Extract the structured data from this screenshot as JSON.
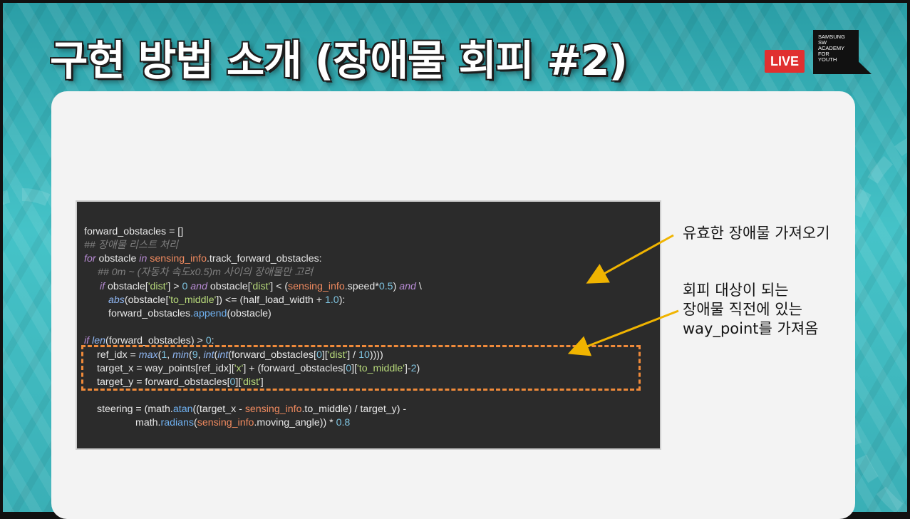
{
  "slide": {
    "title": "구현 방법 소개 (장애물 회피 #2)",
    "live_label": "LIVE",
    "brand_logo_text": "SAMSUNG\nSW\nACADEMY\nFOR\nYOUTH"
  },
  "annotations": {
    "top": "유효한 장애물 가져오기",
    "bottom_line1": "회피 대상이 되는",
    "bottom_line2": "장애물 직전에 있는",
    "bottom_line3": "way_point를 가져옴"
  },
  "code": {
    "l1": "forward_obstacles = []",
    "l2_comment": "## 장애물 리스트 처리",
    "l3_for": "for",
    "l3_a": " obstacle ",
    "l3_in": "in",
    "l3_b": " ",
    "l3_sensing": "sensing_info",
    "l3_c": ".track_forward_obstacles:",
    "l4_comment": "## 0m ~ (자동차 속도x0.5)m 사이의 장애물만 고려",
    "l5_if": "if",
    "l5_a": " obstacle[",
    "l5_dist1": "'dist'",
    "l5_b": "] > ",
    "l5_zero": "0",
    "l5_c": " ",
    "l5_and1": "and",
    "l5_d": " obstacle[",
    "l5_dist2": "'dist'",
    "l5_e": "] < (",
    "l5_sensing": "sensing_info",
    "l5_f": ".speed*",
    "l5_half": "0.5",
    "l5_g": ") ",
    "l5_and2": "and",
    "l5_h": " \\",
    "l6_abs": "abs",
    "l6_a": "(obstacle[",
    "l6_tomid": "'to_middle'",
    "l6_b": "]) <= (half_load_width + ",
    "l6_one": "1.0",
    "l6_c": "):",
    "l7_a": "forward_obstacles",
    "l7_append": ".append",
    "l7_b": "(obstacle)",
    "l8_if": "if",
    "l8_a": " ",
    "l8_len": "len",
    "l8_b": "(forward_obstacles) > ",
    "l8_zero": "0",
    "l8_c": ":",
    "l9_a": "ref_idx = ",
    "l9_max": "max",
    "l9_b": "(",
    "l9_one": "1",
    "l9_c": ", ",
    "l9_min": "min",
    "l9_d": "(",
    "l9_nine": "9",
    "l9_e": ", ",
    "l9_int1": "int",
    "l9_f": "(",
    "l9_int2": "int",
    "l9_g": "(forward_obstacles[",
    "l9_zero": "0",
    "l9_h": "][",
    "l9_dist": "'dist'",
    "l9_i": "] / ",
    "l9_ten": "10",
    "l9_j": "))))",
    "l10_a": "target_x = way_points[ref_idx][",
    "l10_x": "'x'",
    "l10_b": "] + (forward_obstacles[",
    "l10_zero": "0",
    "l10_c": "][",
    "l10_tomid": "'to_middle'",
    "l10_d": "]-",
    "l10_two": "2",
    "l10_e": ")",
    "l11_a": "target_y = forward_obstacles[",
    "l11_zero": "0",
    "l11_b": "][",
    "l11_dist": "'dist'",
    "l11_c": "]",
    "l12_a": "steering = (math.",
    "l12_atan": "atan",
    "l12_b": "((target_x - ",
    "l12_sensing": "sensing_info",
    "l12_c": ".to_middle) / target_y) -",
    "l13_a": "math.",
    "l13_radians": "radians",
    "l13_b": "(",
    "l13_sensing": "sensing_info",
    "l13_c": ".moving_angle)) * ",
    "l13_num": "0.8"
  },
  "colors": {
    "background_teal": "#45c3c8",
    "code_bg": "#2b2b2b",
    "keyword": "#b98cd6",
    "string": "#b7d97a",
    "variable_orange": "#f08a5f",
    "arrow": "#f0b400",
    "dashed_box": "#ef8a3a",
    "live_red": "#e03030"
  }
}
